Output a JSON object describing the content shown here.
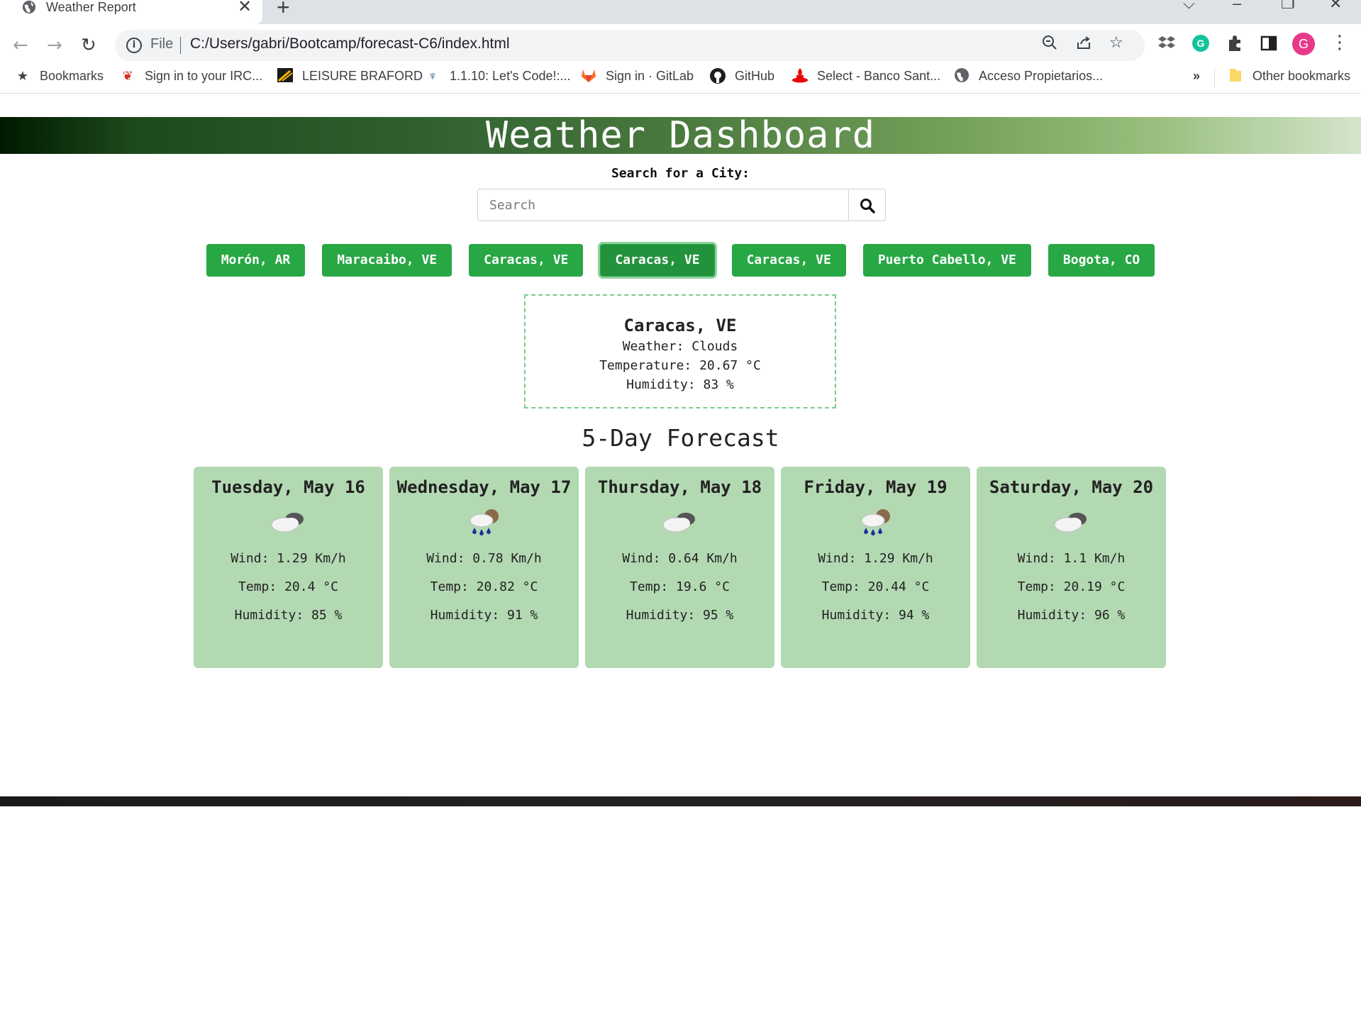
{
  "browser": {
    "tab_title": "Weather Report",
    "tab_close": "✕",
    "new_tab": "+",
    "scheme": "File",
    "url": "C:/Users/gabri/Bootcamp/forecast-C6/index.html",
    "avatar_letter": "G",
    "bookmarks": [
      {
        "label": "Bookmarks",
        "icon": "star-icon"
      },
      {
        "label": "Sign in to your IRC...",
        "icon": "maple-leaf-icon"
      },
      {
        "label": "LEISURE BRAFORD",
        "icon": "leisure-icon"
      },
      {
        "label": "1.1.10: Let's Code!:...",
        "icon": "tree-icon"
      },
      {
        "label": "Sign in · GitLab",
        "icon": "gitlab-icon"
      },
      {
        "label": "GitHub",
        "icon": "github-icon"
      },
      {
        "label": "Select - Banco Sant...",
        "icon": "santander-icon"
      },
      {
        "label": "Acceso Propietarios...",
        "icon": "globe-icon"
      }
    ],
    "overflow": "»",
    "other_bookmarks": "Other bookmarks"
  },
  "page": {
    "title": "Weather Dashboard",
    "search_label": "Search for a City:",
    "search_placeholder": "Search",
    "history": [
      "Morón, AR",
      "Maracaibo, VE",
      "Caracas, VE",
      "Caracas, VE",
      "Caracas, VE",
      "Puerto Cabello, VE",
      "Bogota, CO"
    ],
    "active_history_index": 3,
    "current": {
      "city": "Caracas, VE",
      "weather": "Weather: Clouds",
      "temperature": "Temperature: 20.67 °C",
      "humidity": "Humidity: 83 %"
    },
    "forecast_title": "5-Day Forecast",
    "forecast": [
      {
        "date": "Tuesday, May 16",
        "icon": "clouds-icon",
        "wind": "Wind: 1.29 Km/h",
        "temp": "Temp: 20.4 °C",
        "humidity": "Humidity: 85 %"
      },
      {
        "date": "Wednesday, May 17",
        "icon": "rain-icon",
        "wind": "Wind: 0.78 Km/h",
        "temp": "Temp: 20.82 °C",
        "humidity": "Humidity: 91 %"
      },
      {
        "date": "Thursday, May 18",
        "icon": "clouds-icon",
        "wind": "Wind: 0.64 Km/h",
        "temp": "Temp: 19.6 °C",
        "humidity": "Humidity: 95 %"
      },
      {
        "date": "Friday, May 19",
        "icon": "rain-icon",
        "wind": "Wind: 1.29 Km/h",
        "temp": "Temp: 20.44 °C",
        "humidity": "Humidity: 94 %"
      },
      {
        "date": "Saturday, May 20",
        "icon": "clouds-icon",
        "wind": "Wind: 1.1 Km/h",
        "temp": "Temp: 20.19 °C",
        "humidity": "Humidity: 96 %"
      }
    ]
  },
  "colors": {
    "accent_green": "#28a745",
    "card_bg": "#b3d9b3",
    "header_dark": "#001a00",
    "header_light": "#d4e5cc"
  }
}
